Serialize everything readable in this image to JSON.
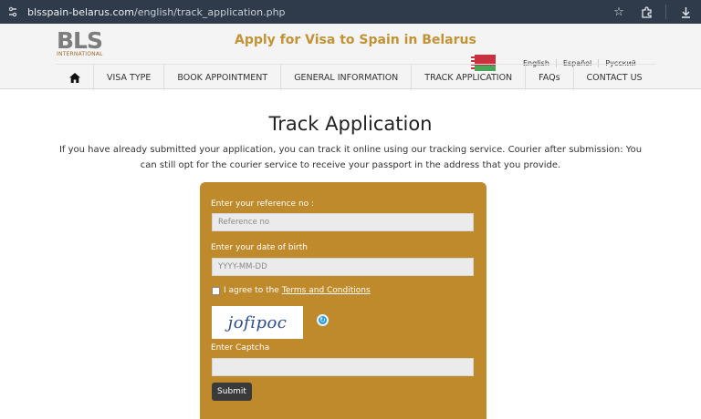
{
  "browser": {
    "url_host": "blsspain-belarus.com",
    "url_path": "/english/track_application.php",
    "icons": [
      "site-settings-icon",
      "star-icon",
      "extensions-icon",
      "download-icon"
    ]
  },
  "header": {
    "logo_text": "BLS",
    "logo_sub": "INTERNATIONAL",
    "headline": "Apply for Visa to Spain in Belarus",
    "languages": [
      "English",
      "Español",
      "Русский"
    ]
  },
  "nav": {
    "items": [
      "VISA TYPE",
      "BOOK APPOINTMENT",
      "GENERAL INFORMATION",
      "TRACK APPLICATION",
      "FAQs",
      "CONTACT US"
    ]
  },
  "main": {
    "title": "Track Application",
    "description": "If you have already submitted your application, you can track it online using our tracking service. Courier after submission: You can still opt for the courier service to receive your passport in the address that you provide."
  },
  "form": {
    "ref_label": "Enter your reference no :",
    "ref_placeholder": "Reference no",
    "dob_label": "Enter your date of birth",
    "dob_placeholder": "YYYY-MM-DD",
    "agree_text": "I agree to the",
    "terms_link": "Terms and Conditions",
    "captcha_image_text": "jofipoc",
    "captcha_label": "Enter Captcha",
    "submit_label": "Submit"
  },
  "colors": {
    "accent": "#c19335",
    "panel": "#bf8a2b",
    "chrome": "#2f3a4a"
  }
}
